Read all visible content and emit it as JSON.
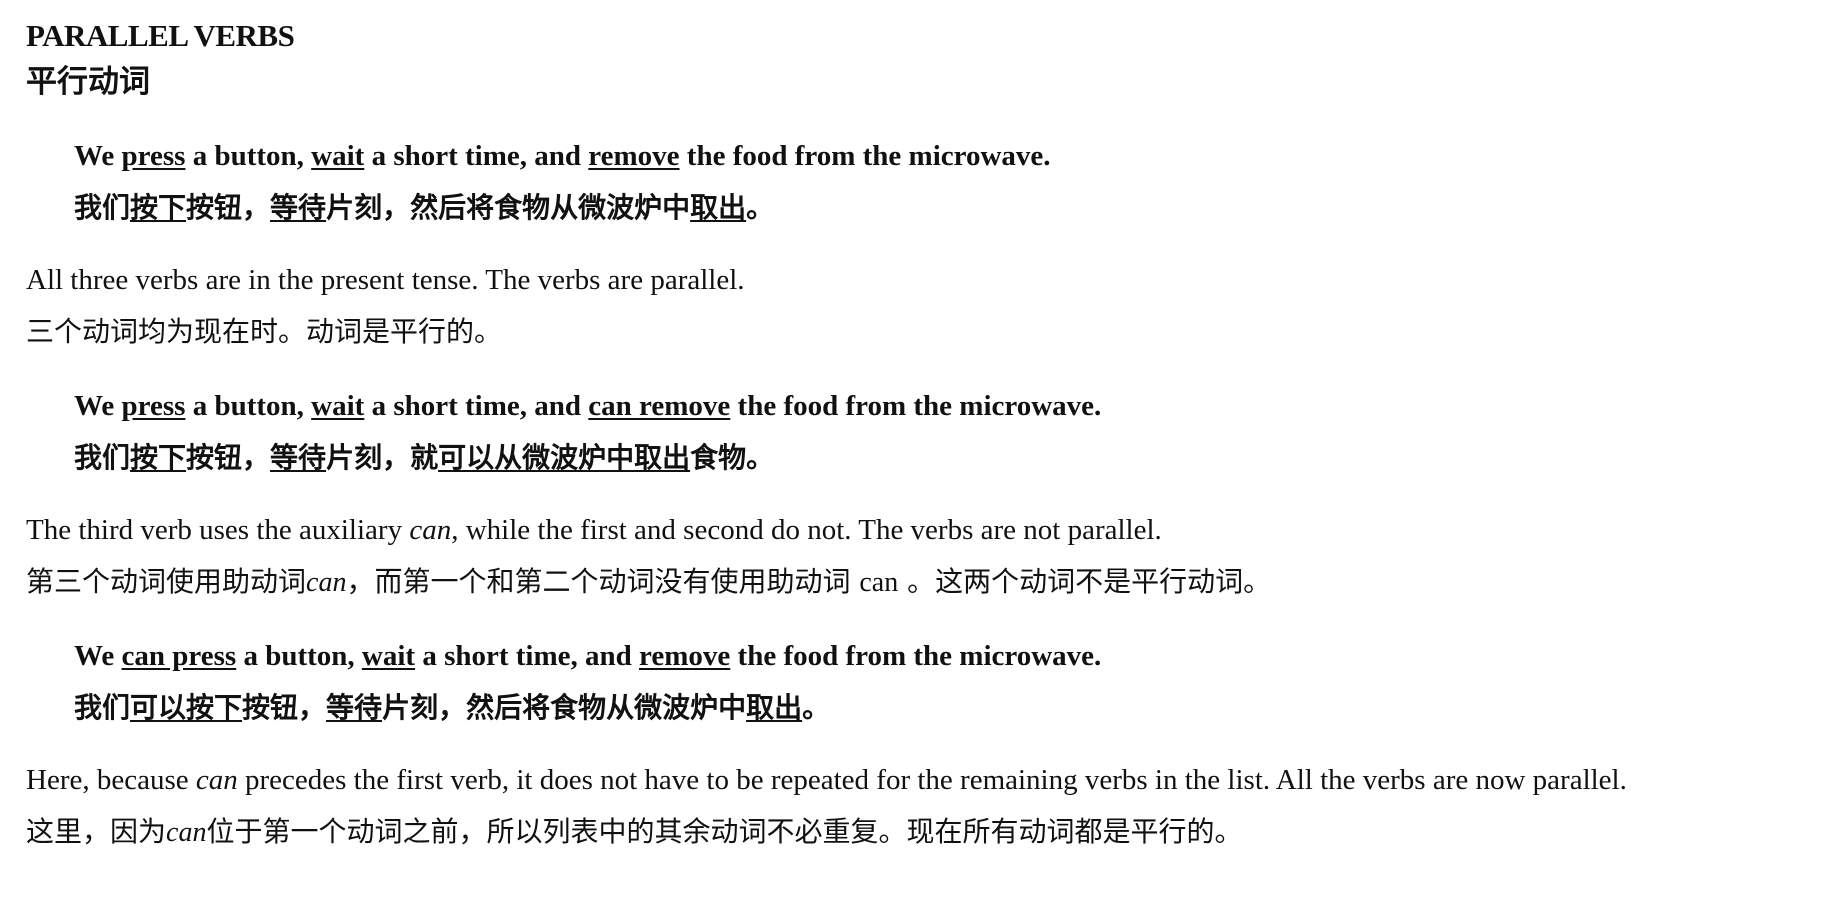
{
  "heading": {
    "en": "PARALLEL VERBS",
    "zh": "平行动词"
  },
  "ex1": {
    "en": [
      "We ",
      "press",
      " a button, ",
      "wait",
      " a short time, and ",
      "remove",
      " the food from the microwave."
    ],
    "zh": [
      "我们",
      "按下",
      "按钮，",
      "等待",
      "片刻，然后将食物从微波炉中",
      "取出",
      "。"
    ]
  },
  "note1": {
    "en": "All three verbs are in the present tense. The verbs are parallel.",
    "zh": "三个动词均为现在时。动词是平行的。"
  },
  "ex2": {
    "en": [
      "We ",
      "press",
      " a button, ",
      "wait",
      " a short time, and ",
      "can remove",
      " the food from the microwave."
    ],
    "zh": [
      "我们",
      "按下",
      "按钮，",
      "等待",
      "片刻，就",
      "可以从微波炉中取出",
      "食物。"
    ]
  },
  "note2": {
    "en": [
      "The third verb uses the auxiliary ",
      "can",
      ", while the first and second do not. The verbs are not parallel."
    ],
    "zh": [
      "第三个动词使用助动词",
      "can",
      "，而第一个和第二个动词没有使用助动词 ",
      "can",
      " 。这两个动词不是平行动词。"
    ]
  },
  "ex3": {
    "en": [
      "We ",
      "can press",
      " a button, ",
      "wait",
      " a short time, and ",
      "remove",
      " the food from the microwave."
    ],
    "zh": [
      "我们",
      "可以按下",
      "按钮，",
      "等待",
      "片刻，然后将食物从微波炉中",
      "取出",
      "。"
    ]
  },
  "note3": {
    "en": [
      "Here, because ",
      "can",
      " precedes the first verb, it does not have to be repeated for the remaining verbs in the list. All the verbs are now parallel."
    ],
    "zh": [
      "这里，因为",
      "can",
      "位于第一个动词之前，所以列表中的其余动词不必重复。现在所有动词都是平行的。"
    ]
  }
}
